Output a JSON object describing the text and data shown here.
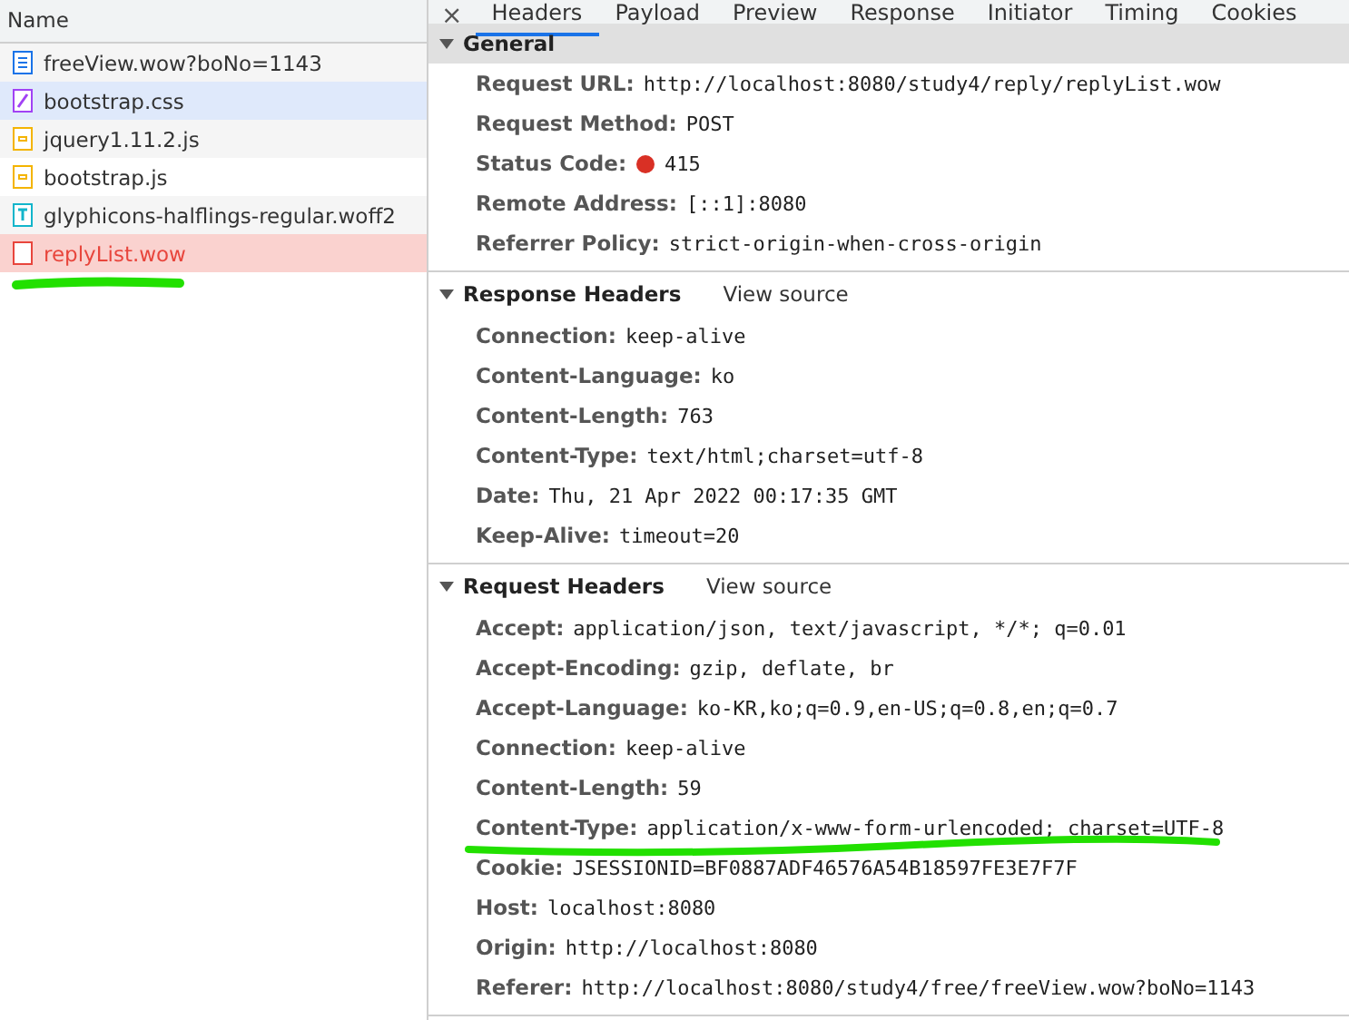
{
  "requests": {
    "column_header": "Name",
    "items": [
      {
        "name": "freeView.wow?boNo=1143",
        "kind": "doc",
        "selected": false,
        "hovered": false,
        "error": false
      },
      {
        "name": "bootstrap.css",
        "kind": "css",
        "selected": false,
        "hovered": true,
        "error": false
      },
      {
        "name": "jquery1.11.2.js",
        "kind": "js",
        "selected": false,
        "hovered": false,
        "error": false
      },
      {
        "name": "bootstrap.js",
        "kind": "js",
        "selected": false,
        "hovered": false,
        "error": false
      },
      {
        "name": "glyphicons-halflings-regular.woff2",
        "kind": "font",
        "selected": false,
        "hovered": false,
        "error": false
      },
      {
        "name": "replyList.wow",
        "kind": "other",
        "selected": true,
        "hovered": false,
        "error": true
      }
    ]
  },
  "close": "×",
  "tabs": [
    {
      "label": "Headers",
      "selected": true
    },
    {
      "label": "Payload",
      "selected": false
    },
    {
      "label": "Preview",
      "selected": false
    },
    {
      "label": "Response",
      "selected": false
    },
    {
      "label": "Initiator",
      "selected": false
    },
    {
      "label": "Timing",
      "selected": false
    },
    {
      "label": "Cookies",
      "selected": false
    }
  ],
  "sections": [
    {
      "title": "General",
      "expanded": true,
      "shaded": true,
      "items": [
        {
          "name": "Request URL:",
          "value": "http://localhost:8080/study4/reply/replyList.wow",
          "kind": "plain"
        },
        {
          "name": "Request Method:",
          "value": "POST",
          "kind": "plain"
        },
        {
          "name": "Status Code:",
          "value": "415",
          "kind": "status",
          "color": "#d93025"
        },
        {
          "name": "Remote Address:",
          "value": "[::1]:8080",
          "kind": "plain"
        },
        {
          "name": "Referrer Policy:",
          "value": "strict-origin-when-cross-origin",
          "kind": "plain"
        }
      ]
    },
    {
      "title": "Response Headers",
      "link": "View source",
      "expanded": true,
      "shaded": false,
      "items": [
        {
          "name": "Connection:",
          "value": "keep-alive",
          "kind": "plain"
        },
        {
          "name": "Content-Language:",
          "value": "ko",
          "kind": "plain"
        },
        {
          "name": "Content-Length:",
          "value": "763",
          "kind": "plain"
        },
        {
          "name": "Content-Type:",
          "value": "text/html;charset=utf-8",
          "kind": "plain"
        },
        {
          "name": "Date:",
          "value": "Thu, 21 Apr 2022 00:17:35 GMT",
          "kind": "plain"
        },
        {
          "name": "Keep-Alive:",
          "value": "timeout=20",
          "kind": "plain"
        }
      ]
    },
    {
      "title": "Request Headers",
      "link": "View source",
      "expanded": true,
      "shaded": false,
      "items": [
        {
          "name": "Accept:",
          "value": "application/json, text/javascript, */*; q=0.01",
          "kind": "plain"
        },
        {
          "name": "Accept-Encoding:",
          "value": "gzip, deflate, br",
          "kind": "plain"
        },
        {
          "name": "Accept-Language:",
          "value": "ko-KR,ko;q=0.9,en-US;q=0.8,en;q=0.7",
          "kind": "plain"
        },
        {
          "name": "Connection:",
          "value": "keep-alive",
          "kind": "plain"
        },
        {
          "name": "Content-Length:",
          "value": "59",
          "kind": "plain"
        },
        {
          "name": "Content-Type:",
          "value": "application/x-www-form-urlencoded; charset=UTF-8",
          "kind": "plain"
        },
        {
          "name": "Cookie:",
          "value": "JSESSIONID=BF0887ADF46576A54B18597FE3E7F7F",
          "kind": "plain"
        },
        {
          "name": "Host:",
          "value": "localhost:8080",
          "kind": "plain"
        },
        {
          "name": "Origin:",
          "value": "http://localhost:8080",
          "kind": "plain"
        },
        {
          "name": "Referer:",
          "value": "http://localhost:8080/study4/free/freeView.wow?boNo=1143",
          "kind": "plain"
        }
      ]
    }
  ]
}
